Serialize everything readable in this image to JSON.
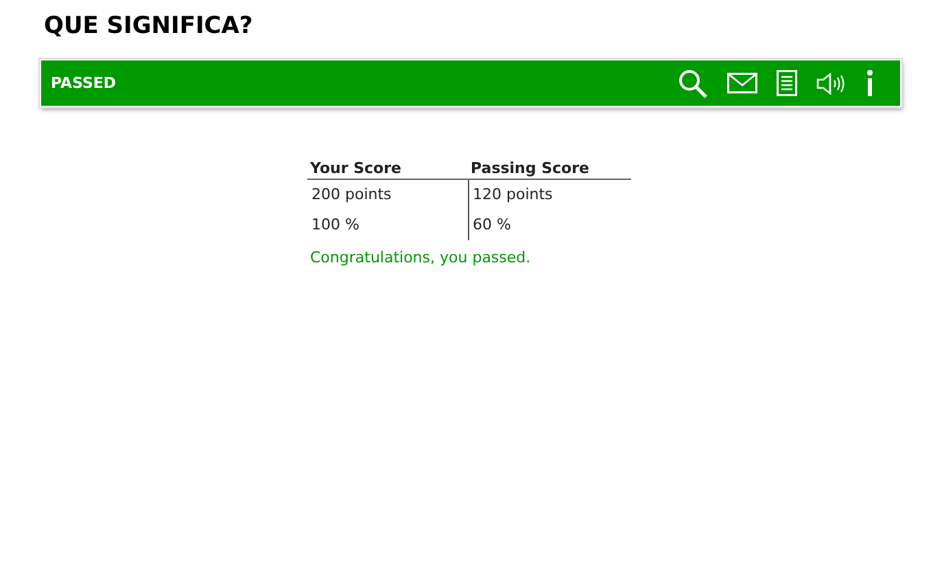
{
  "title": "QUE SIGNIFICA?",
  "status_bar": {
    "label": "PASSED",
    "kind": "passed"
  },
  "toolbar": [
    {
      "kind": "search"
    },
    {
      "kind": "mail"
    },
    {
      "kind": "document"
    },
    {
      "kind": "sound"
    },
    {
      "kind": "info"
    }
  ],
  "table": {
    "columns": [
      "Your Score",
      "Passing Score"
    ],
    "rows": [
      [
        "200 points",
        "120 points"
      ],
      [
        "100 %",
        "60 %"
      ]
    ]
  },
  "message": "Congratulations, you passed."
}
